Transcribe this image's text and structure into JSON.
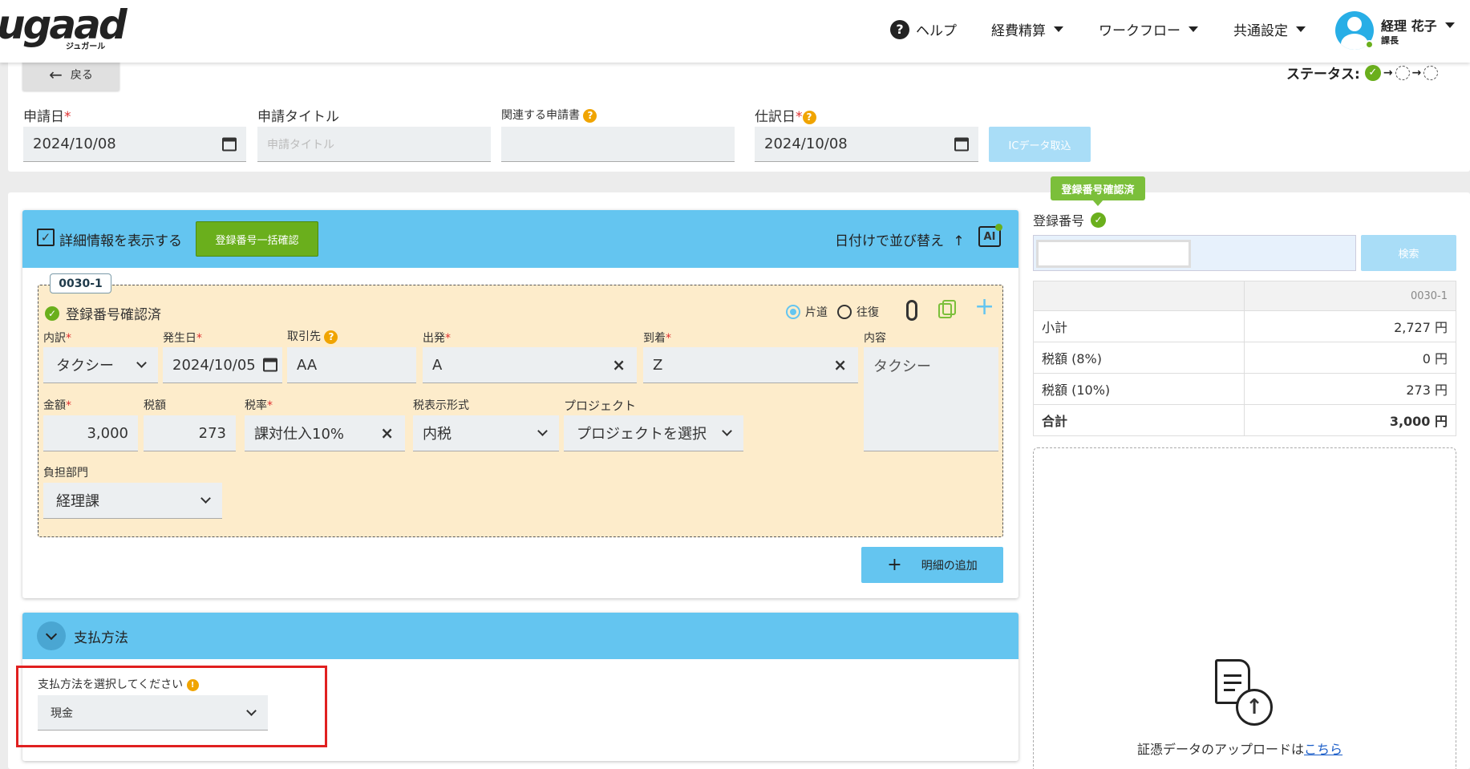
{
  "header": {
    "logo_text": "ugaad",
    "logo_sub": "ジュガール",
    "nav": {
      "help": "ヘルプ",
      "expense": "経費精算",
      "workflow": "ワークフロー",
      "common": "共通設定"
    },
    "user_name": "経理 花子",
    "user_role": "課長"
  },
  "toolbar": {
    "back": "戻る",
    "status_label": "ステータス:"
  },
  "form": {
    "apply_date_label": "申請日",
    "apply_date": "2024/10/08",
    "title_label": "申請タイトル",
    "title_placeholder": "申請タイトル",
    "related_label": "関連する申請書",
    "journal_date_label": "仕訳日",
    "journal_date": "2024/10/08",
    "ic_button": "ICデータ取込"
  },
  "detail": {
    "show_detail": "詳細情報を表示する",
    "bulk_check": "登録番号一括確認",
    "sort_by_date": "日付けで並び替え",
    "ai_label": "AI",
    "item_id": "0030-1",
    "verified": "登録番号確認済",
    "one_way": "片道",
    "round_trip": "往復",
    "fields": {
      "category_label": "内訳",
      "category": "タクシー",
      "date_label": "発生日",
      "date": "2024/10/05",
      "partner_label": "取引先",
      "partner": "AA",
      "from_label": "出発",
      "from": "A",
      "to_label": "到着",
      "to": "Z",
      "content_label": "内容",
      "content": "タクシー",
      "amount_label": "金額",
      "amount": "3,000",
      "tax_label": "税額",
      "tax": "273",
      "rate_label": "税率",
      "rate": "課対仕入10%",
      "tax_display_label": "税表示形式",
      "tax_display": "内税",
      "project_label": "プロジェクト",
      "project": "プロジェクトを選択",
      "dept_label": "負担部門",
      "dept": "経理課"
    },
    "add_item": "明細の追加"
  },
  "payment": {
    "title": "支払方法",
    "select_label": "支払方法を選択してください",
    "method": "現金"
  },
  "side": {
    "tooltip": "登録番号確認済",
    "reg_label": "登録番号",
    "search": "検索",
    "col_id": "0030-1",
    "rows": [
      {
        "label": "小計",
        "value": "2,727 円"
      },
      {
        "label": "税額 (8%)",
        "value": "0 円"
      },
      {
        "label": "税額 (10%)",
        "value": "273 円"
      },
      {
        "label": "合計",
        "value": "3,000 円"
      }
    ],
    "upload_text": "証憑データのアップロードは",
    "upload_link": "こちら"
  },
  "colors": {
    "primary_blue": "#64c5f0",
    "green": "#6aaf1c",
    "card_yellow": "#fdeccb",
    "highlight_red": "#e02020"
  }
}
